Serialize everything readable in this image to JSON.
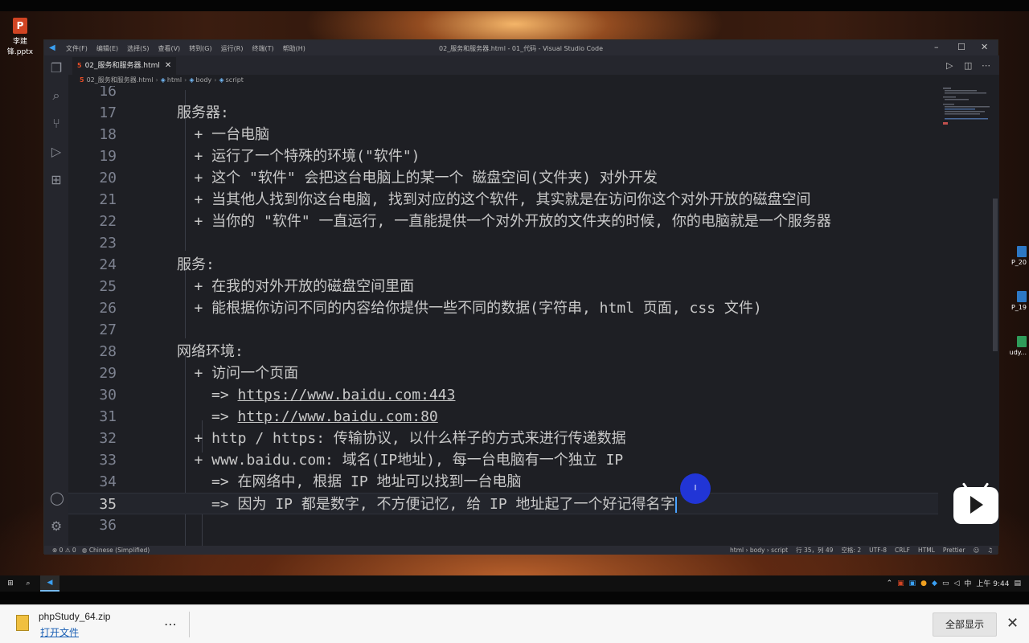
{
  "desktop": {
    "file_icon_label": "李建锋.pptx",
    "side_labels": [
      "P_20",
      "P_19",
      "udy..."
    ]
  },
  "window": {
    "menus": [
      "文件(F)",
      "编辑(E)",
      "选择(S)",
      "查看(V)",
      "转到(G)",
      "运行(R)",
      "终端(T)",
      "帮助(H)"
    ],
    "title": "02_服务和服务器.html - 01_代码 - Visual Studio Code"
  },
  "tab": {
    "label": "02_服务和服务器.html"
  },
  "breadcrumb": [
    "02_服务和服务器.html",
    "html",
    "body",
    "script"
  ],
  "editor": {
    "lines": [
      {
        "n": "16",
        "text": ""
      },
      {
        "n": "17",
        "text": "服务器:"
      },
      {
        "n": "18",
        "text": "+ 一台电脑"
      },
      {
        "n": "19",
        "text": "+ 运行了一个特殊的环境(\"软件\")"
      },
      {
        "n": "20",
        "text": "+ 这个 \"软件\" 会把这台电脑上的某一个 磁盘空间(文件夹) 对外开发"
      },
      {
        "n": "21",
        "text": "+ 当其他人找到你这台电脑, 找到对应的这个软件, 其实就是在访问你这个对外开放的磁盘空间"
      },
      {
        "n": "22",
        "text": "+ 当你的 \"软件\" 一直运行, 一直能提供一个对外开放的文件夹的时候, 你的电脑就是一个服务器"
      },
      {
        "n": "23",
        "text": ""
      },
      {
        "n": "24",
        "text": "服务:"
      },
      {
        "n": "25",
        "text": "+ 在我的对外开放的磁盘空间里面"
      },
      {
        "n": "26",
        "text": "+ 能根据你访问不同的内容给你提供一些不同的数据(字符串, html 页面, css 文件)"
      },
      {
        "n": "27",
        "text": ""
      },
      {
        "n": "28",
        "text": "网络环境:"
      },
      {
        "n": "29",
        "text": "+ 访问一个页面"
      },
      {
        "n": "30",
        "prefix": "=> ",
        "link": "https://www.baidu.com:443"
      },
      {
        "n": "31",
        "prefix": "=> ",
        "link": "http://www.baidu.com:80"
      },
      {
        "n": "32",
        "text": "+ http / https: 传输协议, 以什么样子的方式来进行传递数据"
      },
      {
        "n": "33",
        "text": "+ www.baidu.com: 域名(IP地址), 每一台电脑有一个独立 IP"
      },
      {
        "n": "34",
        "text": "=> 在网络中, 根据 IP 地址可以找到一台电脑"
      },
      {
        "n": "35",
        "text": "=> 因为 IP 都是数字, 不方便记忆, 给 IP 地址起了一个好记得名字"
      },
      {
        "n": "36",
        "text": ""
      }
    ]
  },
  "statusbar": {
    "problems": "⊗ 0 ⚠ 0",
    "language_pack": "Chinese (Simplified)",
    "path": "html › body › script",
    "position": "行 35，列 49",
    "spaces": "空格: 2",
    "encoding": "UTF-8",
    "eol": "CRLF",
    "mode": "HTML",
    "formatter": "Prettier"
  },
  "taskbar": {
    "ime": "中",
    "clock": "上午 9:44"
  },
  "download": {
    "file_name": "phpStudy_64.zip",
    "open_label": "打开文件",
    "show_all_label": "全部显示"
  }
}
